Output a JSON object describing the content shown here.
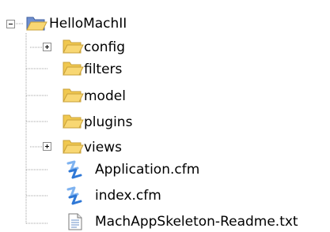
{
  "tree": {
    "root": {
      "label": "HelloMachII",
      "icon": "open-folder-icon",
      "expanded": true
    },
    "children": [
      {
        "label": "config",
        "icon": "folder-icon",
        "expandable": true,
        "expanded": false
      },
      {
        "label": "filters",
        "icon": "folder-icon",
        "expandable": false
      },
      {
        "label": "model",
        "icon": "folder-icon",
        "expandable": false
      },
      {
        "label": "plugins",
        "icon": "folder-icon",
        "expandable": false
      },
      {
        "label": "views",
        "icon": "folder-icon",
        "expandable": true,
        "expanded": false
      },
      {
        "label": "Application.cfm",
        "icon": "cfm-file-icon",
        "expandable": false
      },
      {
        "label": "index.cfm",
        "icon": "cfm-file-icon",
        "expandable": false
      },
      {
        "label": "MachAppSkeleton-Readme.txt",
        "icon": "text-file-icon",
        "expandable": false
      }
    ]
  },
  "colors": {
    "folder_fill": "#f8d773",
    "folder_stroke": "#c9a13a",
    "open_folder_back": "#6f8fcf",
    "cfm_blue": "#2f78d6",
    "cfm_light": "#7fb3f0",
    "tree_line": "#a0a0a0"
  }
}
